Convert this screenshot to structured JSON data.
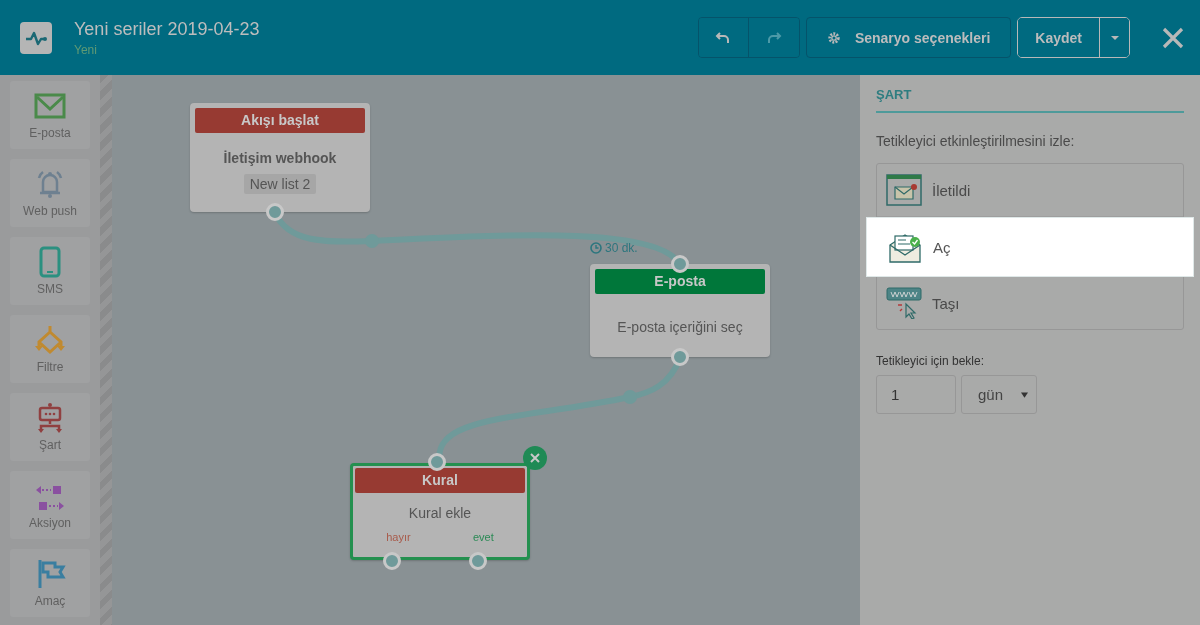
{
  "header": {
    "title": "Yeni seriler 2019-04-23",
    "status": "Yeni",
    "undo": {
      "disabled": false
    },
    "redo": {
      "disabled": true
    },
    "options_button": "Senaryo seçenekleri",
    "save_button": "Kaydet"
  },
  "sidebar": {
    "items": [
      {
        "label": "E-posta",
        "kind": "email"
      },
      {
        "label": "Web push",
        "kind": "push"
      },
      {
        "label": "SMS",
        "kind": "sms"
      },
      {
        "label": "Filtre",
        "kind": "filter"
      },
      {
        "label": "Şart",
        "kind": "condition"
      },
      {
        "label": "Aksiyon",
        "kind": "action"
      },
      {
        "label": "Amaç",
        "kind": "goal"
      }
    ]
  },
  "canvas": {
    "nodes": [
      {
        "kind": "start",
        "title": "Akışı başlat",
        "color": "#973a32",
        "subtitle": "İletişim webhook",
        "tag": "New list 2",
        "selected": false
      },
      {
        "kind": "step",
        "title": "E-posta",
        "color": "#00773a",
        "delay": "30 dk.",
        "body": "E-posta içeriğini seç",
        "selected": false
      },
      {
        "kind": "rule",
        "title": "Kural",
        "color": "#973a32",
        "body": "Kural ekle",
        "no": "hayır",
        "yes": "evet",
        "selected": true
      }
    ]
  },
  "panel": {
    "section": "ŞART",
    "prompt": "Tetikleyici etkinleştirilmesini izle:",
    "options": [
      {
        "label": "İletildi",
        "kind": "delivered",
        "selected": false
      },
      {
        "label": "Aç",
        "kind": "open",
        "selected": true
      },
      {
        "label": "Taşı",
        "kind": "click",
        "selected": false
      }
    ],
    "wait_label": "Tetikleyici için bekle:",
    "wait_value": "1",
    "wait_unit": "gün"
  }
}
